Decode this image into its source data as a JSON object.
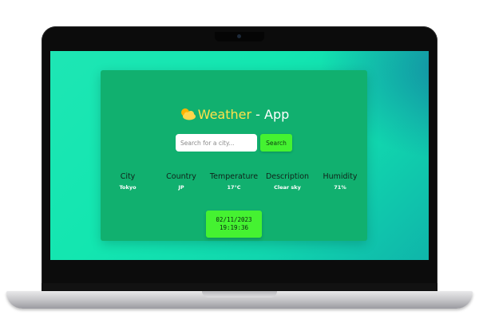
{
  "app": {
    "title_prefix": "Weather",
    "title_suffix": " - App",
    "title_icon": "sun-cloud-icon",
    "accent_color": "#ffe24a",
    "card_color": "#11b06f",
    "button_color": "#45f231"
  },
  "search": {
    "placeholder": "Search for a city...",
    "value": "",
    "button_label": "Search"
  },
  "weather": {
    "columns": [
      {
        "label": "City",
        "value": "Tokyo"
      },
      {
        "label": "Country",
        "value": "JP"
      },
      {
        "label": "Temperature",
        "value": "17°C"
      },
      {
        "label": "Description",
        "value": "Clear sky"
      },
      {
        "label": "Humidity",
        "value": "71%"
      }
    ]
  },
  "datetime": {
    "date": "02/11/2023",
    "time": "19:19:36"
  }
}
